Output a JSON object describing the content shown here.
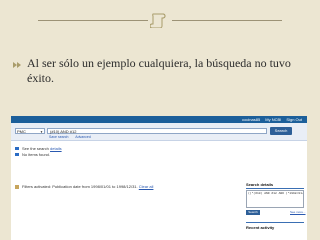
{
  "slide": {
    "bullet_text": "Al ser sólo un ejemplo cualquiera, la búsqueda no tuvo éxito.",
    "colors": {
      "background": "#ece6d2",
      "rule": "#9c9276",
      "bullet": "#a99c6a"
    }
  },
  "screenshot": {
    "topbar_links": [
      "cocinas85",
      "My NCBI",
      "Sign Out"
    ],
    "database": "PMC",
    "query": "(#10) AND #12",
    "search_button": "Search",
    "sublinks": [
      "Save search",
      "Advanced"
    ],
    "items": [
      {
        "prefix": "See the search",
        "link": "details"
      },
      {
        "prefix": "",
        "link": "No items found."
      }
    ],
    "filter_text": "Filters activated: Publication date from 1998/01/01 to 1998/12/31.",
    "filter_link": "Clear all",
    "search_details": {
      "title": "Search details",
      "query_text": "((\"(#10) AND #12 AND (\"1998/01/01\"[PDAT] : \"1998/12/31\"[PDAT])",
      "button": "Search",
      "see_more": "See more...",
      "recent_title": "Recent activity"
    },
    "colors": {
      "topbar": "#1c5f9a",
      "button": "#2d5f98",
      "link": "#2a59b0"
    }
  }
}
